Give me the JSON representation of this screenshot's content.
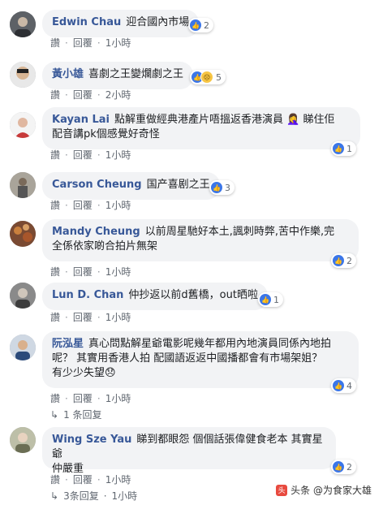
{
  "actions": {
    "like": "讚",
    "reply": "回覆",
    "dot": "·"
  },
  "comments": [
    {
      "author": "Edwin Chau",
      "text": "迎合國內市場",
      "reactions": "2",
      "time": "1小時"
    },
    {
      "author": "黃小雄",
      "text": "喜劇之王變爛劇之王",
      "reactions": "5",
      "time": "2小時"
    },
    {
      "author": "Kayan Lai",
      "text": "點解重做經典港產片唔搵返香港演員 🤦‍♀️ 睇住佢",
      "text2": "配音講pk個感覺好奇怪",
      "reactions": "1",
      "time": "1小時"
    },
    {
      "author": "Carson Cheung",
      "text": "国产喜剧之王",
      "reactions": "3",
      "time": "1小時"
    },
    {
      "author": "Mandy Cheung",
      "text": "以前周星馳好本土,諷刺時弊,苦中作樂,完",
      "text2": "全係依家啲合拍片無架",
      "reactions": "2",
      "time": "1小時"
    },
    {
      "author": "Lun D. Chan",
      "text": "仲抄返以前d舊橋，out晒啦",
      "reactions": "1",
      "time": "1小時"
    },
    {
      "author": "阮泓星",
      "text": "真心問點解星爺電影呢幾年都用內地演員同係內地拍",
      "text2": "呢？ 其實用香港人拍 配國語返返中國播都會有市場架姐？",
      "text3": "有少少失望😞",
      "reactions": "4",
      "time": "1小時",
      "reply_count": "1 条回复"
    },
    {
      "author": "Wing Sze Yau",
      "text": "睇到都眼怨 個個話張偉健食老本 其實星爺",
      "text2": "仲嚴重",
      "reactions": "2",
      "time": "1小時",
      "reply_count": "3条回复"
    }
  ],
  "watermark": {
    "logo": "头",
    "text": "头条 @为食家大雄"
  }
}
